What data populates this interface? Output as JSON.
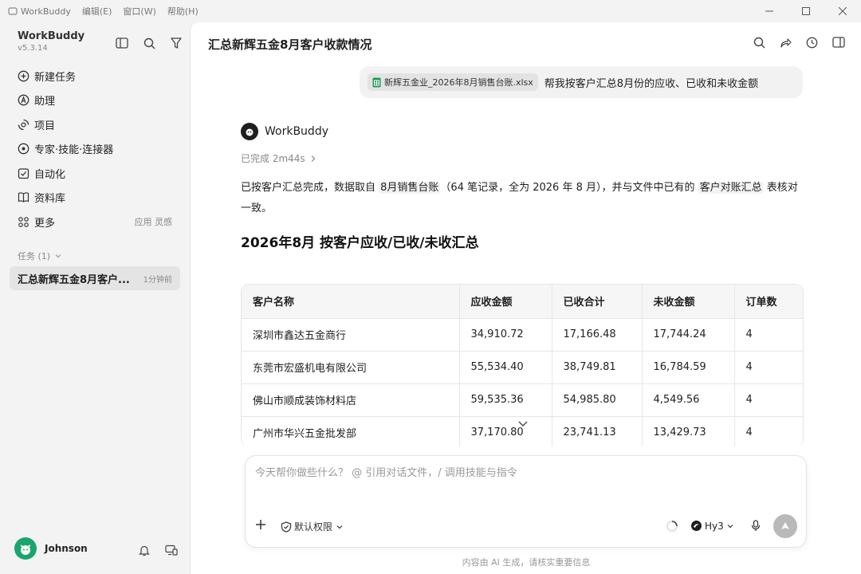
{
  "titlebar": {
    "app_name": "WorkBuddy",
    "menus": [
      "编辑(E)",
      "窗口(W)",
      "帮助(H)"
    ]
  },
  "sidebar": {
    "brand": "WorkBuddy",
    "version": "v5.3.14",
    "nav": [
      {
        "label": "新建任务",
        "icon": "plus-circle-icon"
      },
      {
        "label": "助理",
        "icon": "assistant-icon"
      },
      {
        "label": "项目",
        "icon": "project-icon"
      },
      {
        "label": "专家·技能·连接器",
        "icon": "expert-icon"
      },
      {
        "label": "自动化",
        "icon": "automation-icon"
      },
      {
        "label": "资料库",
        "icon": "library-icon"
      },
      {
        "label": "更多",
        "icon": "more-grid-icon",
        "extra": "应用 灵感"
      }
    ],
    "tasks_header": "任务 (1)",
    "task": {
      "title": "汇总新辉五金8月客户...",
      "time": "1分钟前"
    },
    "user_name": "Johnson"
  },
  "main": {
    "title": "汇总新辉五金8月客户收款情况",
    "user_message": {
      "file": "新辉五金业_2026年8月销售台账.xlsx",
      "text": "帮我按客户汇总8月份的应收、已收和未收金额"
    },
    "bot_name": "WorkBuddy",
    "status": "已完成 2m44s",
    "answer": {
      "p1": "已按客户汇总完成，数据取自 ",
      "hl1": "8月销售台账",
      "p2": "（64 笔记录，全为 2026 年 8 月），并与文件中已有的 ",
      "hl2": "客户对账汇总",
      "p3": " 表核对一致。"
    },
    "heading": "2026年8月 按客户应收/已收/未收汇总",
    "table": {
      "headers": [
        "客户名称",
        "应收金额",
        "已收合计",
        "未收金额",
        "订单数"
      ],
      "rows": [
        [
          "深圳市鑫达五金商行",
          "34,910.72",
          "17,166.48",
          "17,744.24",
          "4"
        ],
        [
          "东莞市宏盛机电有限公司",
          "55,534.40",
          "38,749.81",
          "16,784.59",
          "4"
        ],
        [
          "佛山市顺成装饰材料店",
          "59,535.36",
          "54,985.80",
          "4,549.56",
          "4"
        ],
        [
          "广州市华兴五金批发部",
          "37,170.80",
          "23,741.13",
          "13,429.73",
          "4"
        ]
      ]
    }
  },
  "composer": {
    "placeholder": "今天帮你做些什么？ @ 引用对话文件，/ 调用技能与指令",
    "permission": "默认权限",
    "model": "Hy3"
  },
  "footer_note": "内容由 AI 生成，请核实重要信息"
}
